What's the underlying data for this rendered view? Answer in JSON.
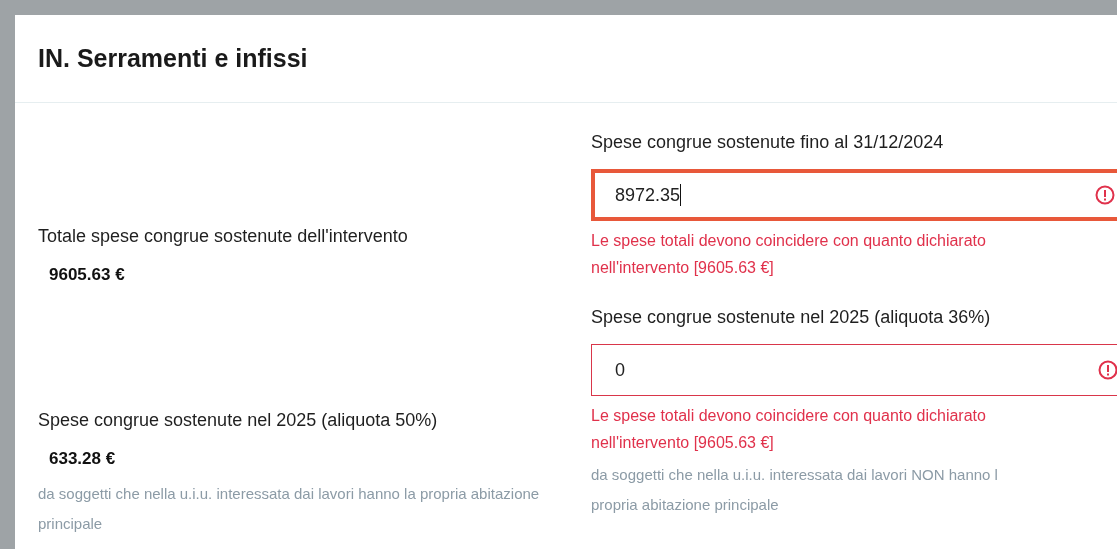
{
  "dialog": {
    "title": "IN. Serramenti e infissi"
  },
  "summary": [
    {
      "label": "Totale spese congrue sostenute dell'intervento",
      "value": "9605.63 €"
    },
    {
      "label": "Spese congrue sostenute nel 2025 (aliquota 50%)",
      "value": "633.28 €",
      "hint": "da soggetti che nella u.i.u. interessata dai lavori hanno la propria abitazione principale"
    }
  ],
  "fields": [
    {
      "label": "Spese congrue sostenute fino al 31/12/2024",
      "value": "8972.35",
      "focused": true,
      "invalid": true,
      "error": "Le spese totali devono coincidere con quanto dichiarato nell'intervento [9605.63 €]"
    },
    {
      "label": "Spese congrue sostenute nel 2025 (aliquota 36%)",
      "value": "0",
      "focused": false,
      "invalid": true,
      "error": "Le spese totali devono coincidere con quanto dichiarato nell'intervento [9605.63 €]",
      "hint_lines": [
        "da soggetti che nella u.i.u. interessata dai lavori NON hanno l",
        "propria abitazione principale"
      ]
    }
  ]
}
